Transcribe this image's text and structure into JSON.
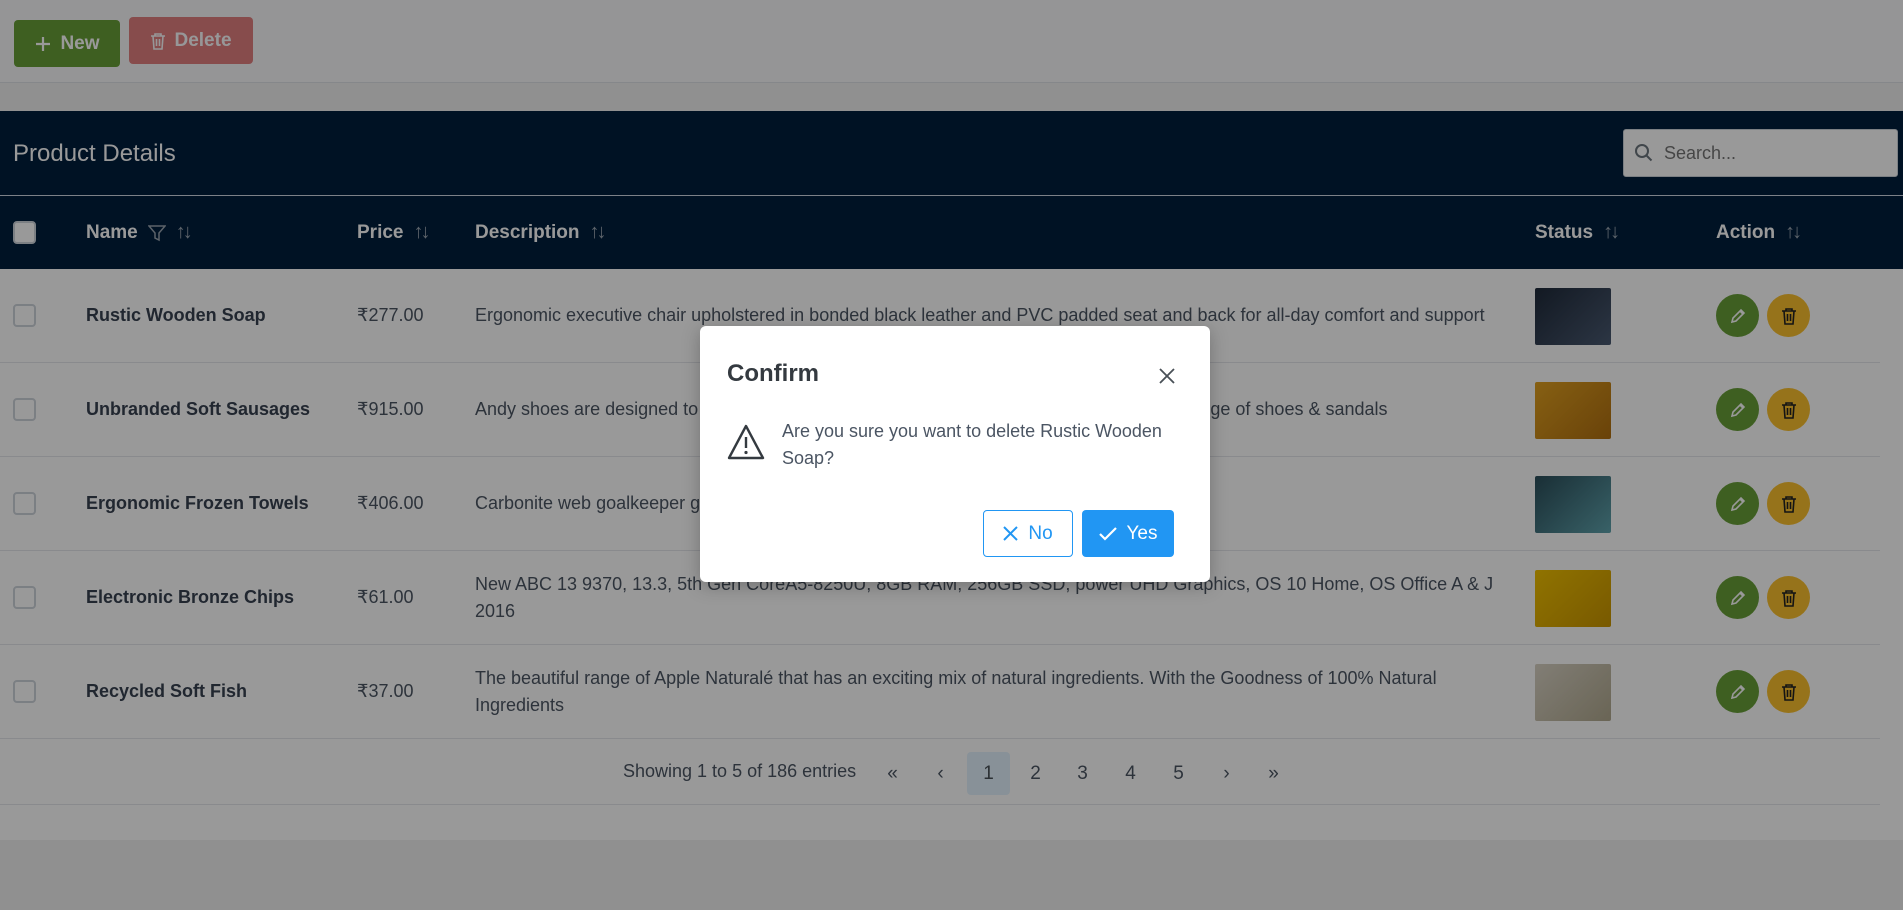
{
  "toolbar": {
    "new_label": "New",
    "delete_label": "Delete"
  },
  "panel": {
    "title": "Product Details",
    "search_placeholder": "Search..."
  },
  "columns": {
    "name": "Name",
    "price": "Price",
    "description": "Description",
    "status": "Status",
    "action": "Action"
  },
  "rows": [
    {
      "name": "Rustic Wooden Soap",
      "price": "₹277.00",
      "description": "Ergonomic executive chair upholstered in bonded black leather and PVC padded seat and back for all-day comfort and support",
      "image_color": "#1f2a3a"
    },
    {
      "name": "Unbranded Soft Sausages",
      "price": "₹915.00",
      "description": "Andy shoes are designed to keeping in mind durability as well as trends, the most stylish range of shoes & sandals",
      "image_color": "#d9901c"
    },
    {
      "name": "Ergonomic Frozen Towels",
      "price": "₹406.00",
      "description": "Carbonite web goalkeeper gloves are ergonomically designed to give easy fit",
      "image_color": "#3d7d8a"
    },
    {
      "name": "Electronic Bronze Chips",
      "price": "₹61.00",
      "description": "New ABC 13 9370, 13.3, 5th Gen CoreA5-8250U, 8GB RAM, 256GB SSD, power UHD Graphics, OS 10 Home, OS Office A & J 2016",
      "image_color": "#e6b400"
    },
    {
      "name": "Recycled Soft Fish",
      "price": "₹37.00",
      "description": "The beautiful range of Apple Naturalé that has an exciting mix of natural ingredients. With the Goodness of 100% Natural Ingredients",
      "image_color": "#c9c2b2"
    }
  ],
  "paginator": {
    "summary": "Showing 1 to 5 of 186 entries",
    "pages": [
      "1",
      "2",
      "3",
      "4",
      "5"
    ],
    "current_page": "1"
  },
  "dialog": {
    "title": "Confirm",
    "message": "Are you sure you want to delete Rustic Wooden Soap?",
    "no_label": "No",
    "yes_label": "Yes"
  },
  "colors": {
    "primary": "#2196f3",
    "success": "#689f38",
    "danger": "#d32f2f",
    "warning": "#fbc02d",
    "header_bg": "#011e3c"
  }
}
